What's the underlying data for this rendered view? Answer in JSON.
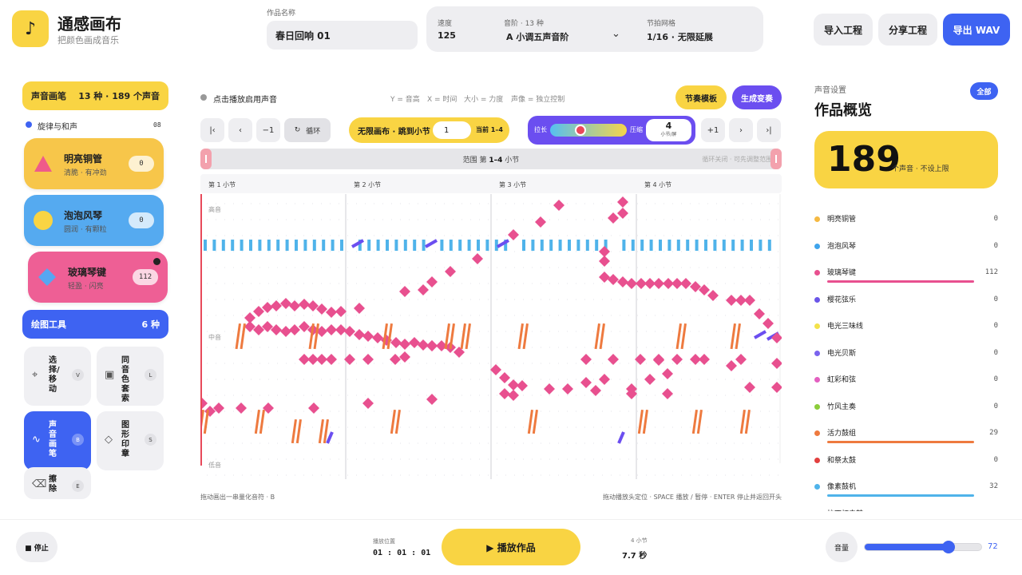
{
  "app": {
    "logo_glyph": "♪",
    "title": "通感画布",
    "subtitle": "把颜色画成音乐"
  },
  "header": {
    "name_label": "作品名称",
    "name_value": "春日回响 01",
    "tempo_label": "速度",
    "tempo_value": "125",
    "scale_label": "音阶 · 13 种",
    "scale_value": "A 小调五声音阶",
    "grid_label": "节拍网格",
    "grid_value": "1/16 · 无限延展",
    "import_label": "导入工程",
    "share_label": "分享工程",
    "export_label": "导出 WAV"
  },
  "brushes": {
    "title": "声音画笔",
    "summary": "13 种 · 189 个声音",
    "category_label": "旋律与和声",
    "category_count": "08",
    "items": [
      {
        "name": "明亮铜管",
        "sub": "清脆 · 有冲劲",
        "count": "0",
        "bg": "#f7c64a",
        "shape": "triangle",
        "iconColor": "#ef5b8a"
      },
      {
        "name": "泡泡风琴",
        "sub": "圆润 · 有颗粒",
        "count": "0",
        "bg": "#55aaf0",
        "shape": "circle",
        "iconColor": "#f9d443"
      },
      {
        "name": "玻璃琴键",
        "sub": "轻盈 · 闪亮",
        "count": "112",
        "bg": "#ee5f95",
        "shape": "diamond",
        "iconColor": "#56a6f2"
      }
    ]
  },
  "tools": {
    "title": "绘图工具",
    "count": "6 种",
    "items": [
      {
        "name": "选择/移动",
        "key": "V",
        "icon": "crosshair-icon",
        "glyph": "⌖"
      },
      {
        "name": "同音色套索",
        "key": "L",
        "icon": "lasso-icon",
        "glyph": "▣"
      },
      {
        "name": "声音画笔",
        "key": "B",
        "icon": "brush-icon",
        "glyph": "∿"
      },
      {
        "name": "图形印章",
        "key": "S",
        "icon": "stamp-icon",
        "glyph": "◇"
      },
      {
        "name": "擦除",
        "key": "E",
        "icon": "eraser-icon",
        "glyph": "⌫"
      }
    ]
  },
  "editor": {
    "play_hint": "点击播放启用声音",
    "axis_y": "Y = 音高",
    "axis_x": "X = 时间",
    "axis_size": "大小 = 力度",
    "axis_voice": "声像 = 独立控制",
    "rhythm_template": "节奏模板",
    "generate_variation": "生成变奏",
    "btn_start": "|‹",
    "btn_prev": "‹",
    "btn_minus": "−1",
    "loop_glyph": "↻",
    "btn_loop": "循环",
    "jump_label": "无限画布 · 跳到小节",
    "jump_value": "1",
    "jump_current": "当前 1–4",
    "zoom_stretch": "拉长",
    "zoom_compress": "压缩",
    "zoom_level": 0.4,
    "zoom_value": "4",
    "zoom_unit": "小节/屏",
    "btn_plus": "+1",
    "btn_next": "›",
    "btn_end": "›|",
    "range_prefix": "范围 第 ",
    "range_bold": "1–4",
    "range_suffix": " 小节",
    "loop_note": "循环关闭 · 可先调整范围",
    "bars": [
      "第 1 小节",
      "第 2 小节",
      "第 3 小节",
      "第 4 小节"
    ],
    "pitch_high": "高音",
    "pitch_mid": "中音",
    "pitch_low": "低音",
    "foot_left": "拖动画出一串量化音符 · B",
    "foot_right": "拖动播放头定位 · SPACE 播放 / 暂停 · ENTER 停止并返回开头"
  },
  "overview": {
    "section": "声音设置",
    "all_label": "全部",
    "title": "作品概览",
    "total": "189",
    "total_sub": "个声音 · 不设上限",
    "voices": [
      {
        "name": "明亮铜管",
        "count": "0",
        "color": "#f5b942",
        "share": 0
      },
      {
        "name": "泡泡风琴",
        "count": "0",
        "color": "#3fa4ec",
        "share": 0
      },
      {
        "name": "玻璃琴键",
        "count": "112",
        "color": "#e8508f",
        "share": 1
      },
      {
        "name": "樱花弦乐",
        "count": "0",
        "color": "#6a55e8",
        "share": 0
      },
      {
        "name": "电光三味线",
        "count": "0",
        "color": "#f3e24a",
        "share": 0
      },
      {
        "name": "电光贝斯",
        "count": "0",
        "color": "#7a63ee",
        "share": 0
      },
      {
        "name": "虹彩和弦",
        "count": "0",
        "color": "#e35fc0",
        "share": 0
      },
      {
        "name": "竹风主奏",
        "count": "0",
        "color": "#8ccd3b",
        "share": 0
      },
      {
        "name": "活力鼓组",
        "count": "29",
        "color": "#ee7a3f",
        "share": 1
      },
      {
        "name": "和祭太鼓",
        "count": "0",
        "color": "#e2403f",
        "share": 0
      },
      {
        "name": "像素鼓机",
        "count": "32",
        "color": "#4fb3ea",
        "share": 1
      },
      {
        "name": "拉丁打击鼓",
        "count": "",
        "color": "#f29a3c",
        "share": 0
      }
    ]
  },
  "footer": {
    "stop_label": "■ 停止",
    "pos_label": "播放位置",
    "pos_value": "01 : 01 : 01",
    "play_label": "▶  播放作品",
    "dur_label": "4 小节",
    "dur_value": "7.7 秒",
    "volume_label": "音量",
    "volume_value": "72",
    "volume_level": 0.72
  },
  "colors": {
    "yellow": "#f9d443",
    "blue": "#3e63f2",
    "purple": "#6b4ef0",
    "pink": "#e8508f",
    "orange": "#ee7a3f",
    "cyan": "#4fb3ea"
  }
}
